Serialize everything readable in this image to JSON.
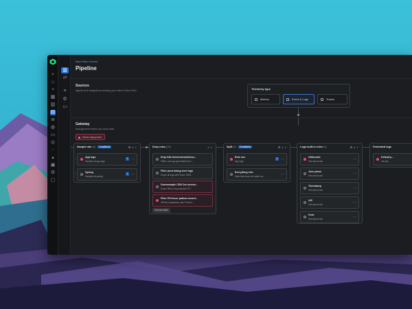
{
  "app": {
    "breadcrumb": "New Relic Control",
    "title": "Pipeline"
  },
  "rail_icons": [
    "logo-icon",
    "search-icon",
    "home-icon",
    "plus-icon",
    "grid-icon",
    "book-icon",
    "pipeline-icon",
    "globe-icon",
    "layers-icon",
    "file-icon",
    "users-icon",
    "bulb-icon",
    "alert-icon",
    "apps-icon",
    "gear-icon",
    "window-icon"
  ],
  "sources": {
    "title": "Sources",
    "description": "Agents and integrations sending your data to New Relic.",
    "telemetry": {
      "title": "Telemetry type",
      "options": [
        "Metrics",
        "Event & Logs",
        "Traces"
      ],
      "selected": "Event & Logs"
    }
  },
  "gateway": {
    "title": "Gateway",
    "description": "Management before you send data.",
    "deploy_label": "Needs deployment"
  },
  "columns": [
    {
      "title": "Sample rate",
      "count": "(2)",
      "conditions": "Conditions",
      "cards": [
        {
          "title": "App logs",
          "subtitle": "Sample all app logs",
          "badge": "1"
        },
        {
          "title": "Syslog",
          "subtitle": "Sample all syslog",
          "badge": "1"
        }
      ]
    },
    {
      "title": "Drop rules",
      "count": "(29)",
      "cards": [
        {
          "title": "Drop K8s liveness/readiness...",
          "subtitle": "Filters out logs generated by K..."
        },
        {
          "title": "Filter prod debug-level logs",
          "subtitle": "Drops all logs with 'level: DEB..."
        },
        {
          "title": "Downsample CDN 2xx access...",
          "subtitle": "Drops 95% of successful HTT..."
        },
        {
          "title": "Filter PHI from 'patient-record...",
          "subtitle": "HIPAA compliance rule. Preven..."
        }
      ],
      "more": "16 more rules"
    },
    {
      "title": "Split",
      "count": "(2)",
      "conditions": "Conditions",
      "cards": [
        {
          "title": "Rule one",
          "subtitle": "App logs",
          "badge": "1"
        },
        {
          "title": "Everything else",
          "subtitle": "Data that does not match co..."
        }
      ]
    },
    {
      "title": "Logs built-in rules",
      "count": "(5)",
      "cards": [
        {
          "title": "Obfuscate",
          "subtitle": "Info about rule"
        },
        {
          "title": "Json parse",
          "subtitle": "Info about rule"
        },
        {
          "title": "Timestamp",
          "subtitle": "Info about rule"
        },
        {
          "title": "UIC",
          "subtitle": "Info about rule"
        },
        {
          "title": "Grok",
          "subtitle": "Info about rule"
        }
      ]
    },
    {
      "title": "Federated logs",
      "cards": [
        {
          "title": "Default p...",
          "subtitle": "Info ab..."
        }
      ]
    }
  ],
  "colors": {
    "accent": "#1e6fd9",
    "window_bg": "#1b1d20",
    "sky": "#34b5d3",
    "alert": "#e4478a"
  }
}
